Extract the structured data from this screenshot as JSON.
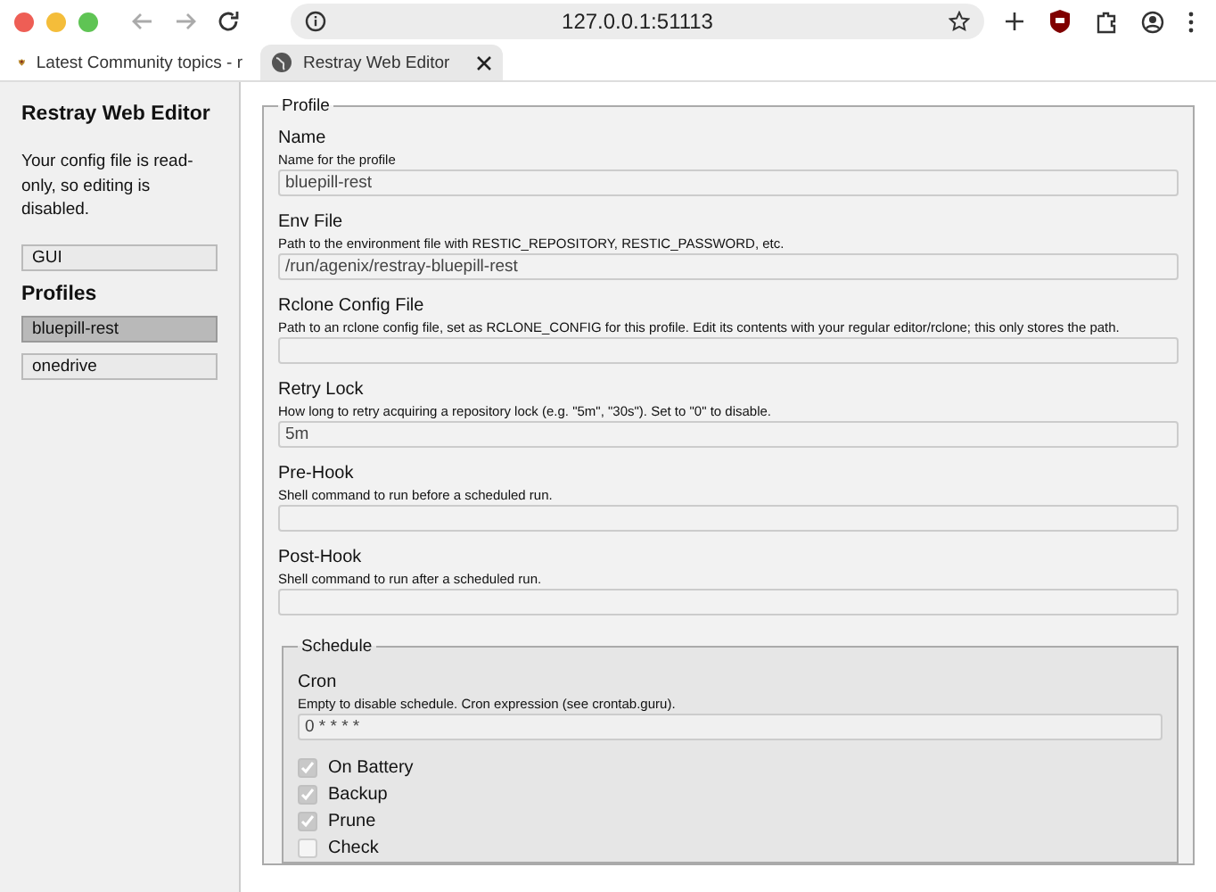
{
  "browser": {
    "url": "127.0.0.1:51113",
    "tabs": [
      {
        "title": "Latest Community topics - r",
        "selected": false,
        "kind": "forum"
      },
      {
        "title": "Restray Web Editor",
        "selected": true,
        "kind": "globe"
      }
    ]
  },
  "sidebar": {
    "title": "Restray Web Editor",
    "notice": "Your config file is read-only, so editing is disabled.",
    "gui_button": "GUI",
    "profiles_heading": "Profiles",
    "profiles": [
      {
        "name": "bluepill-rest",
        "selected": true
      },
      {
        "name": "onedrive",
        "selected": false
      }
    ]
  },
  "profile": {
    "legend": "Profile",
    "fields": [
      {
        "label": "Name",
        "help": "Name for the profile",
        "value": "bluepill-rest"
      },
      {
        "label": "Env File",
        "help": "Path to the environment file with RESTIC_REPOSITORY, RESTIC_PASSWORD, etc.",
        "value": "/run/agenix/restray-bluepill-rest"
      },
      {
        "label": "Rclone Config File",
        "help": "Path to an rclone config file, set as RCLONE_CONFIG for this profile. Edit its contents with your regular editor/rclone; this only stores the path."
      },
      {
        "label": "Retry Lock",
        "help": "How long to retry acquiring a repository lock (e.g. \"5m\", \"30s\"). Set to \"0\" to disable.",
        "value": "5m"
      },
      {
        "label": "Pre-Hook",
        "help": "Shell command to run before a scheduled run."
      },
      {
        "label": "Post-Hook",
        "help": "Shell command to run after a scheduled run."
      }
    ],
    "schedule": {
      "legend": "Schedule",
      "cron": {
        "label": "Cron",
        "help": "Empty to disable schedule. Cron expression (see crontab.guru).",
        "value": "0 * * * *"
      },
      "options": [
        {
          "label": "On Battery",
          "checked": true
        },
        {
          "label": "Backup",
          "checked": true
        },
        {
          "label": "Prune",
          "checked": true
        },
        {
          "label": "Check",
          "checked": false
        }
      ]
    }
  }
}
